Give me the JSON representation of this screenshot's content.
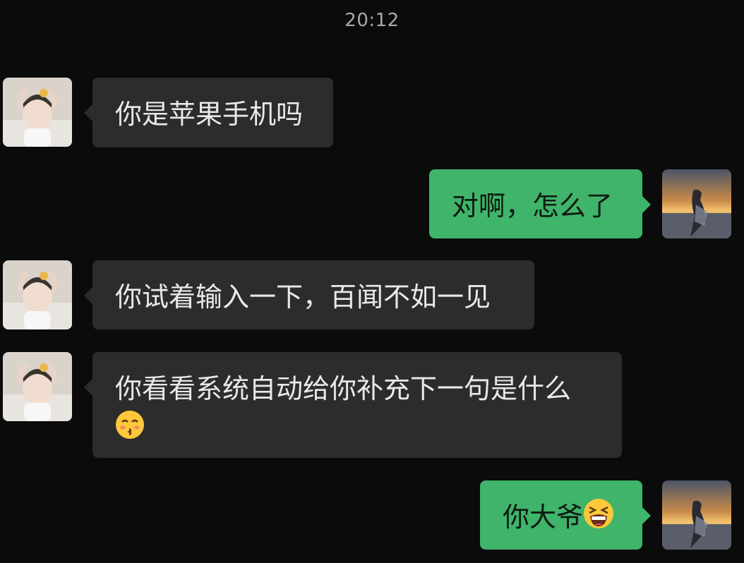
{
  "header": {
    "time": "20:12"
  },
  "messages": [
    {
      "side": "in",
      "avatar": "friend-avatar",
      "text": "你是苹果手机吗"
    },
    {
      "side": "out",
      "avatar": "self-avatar",
      "text": "对啊，怎么了"
    },
    {
      "side": "in",
      "avatar": "friend-avatar",
      "text": "你试着输入一下，百闻不如一见"
    },
    {
      "side": "in",
      "avatar": "friend-avatar",
      "text": "你看看系统自动给你补充下一句是什么",
      "emoji": "kissing-face-emoji"
    },
    {
      "side": "out",
      "avatar": "self-avatar",
      "text": "你大爷",
      "emoji": "tired-face-emoji"
    }
  ],
  "colors": {
    "background": "#0b0b0b",
    "incoming_bubble": "#2c2c2c",
    "outgoing_bubble": "#3fb46a",
    "timestamp": "#a9a9a9"
  }
}
